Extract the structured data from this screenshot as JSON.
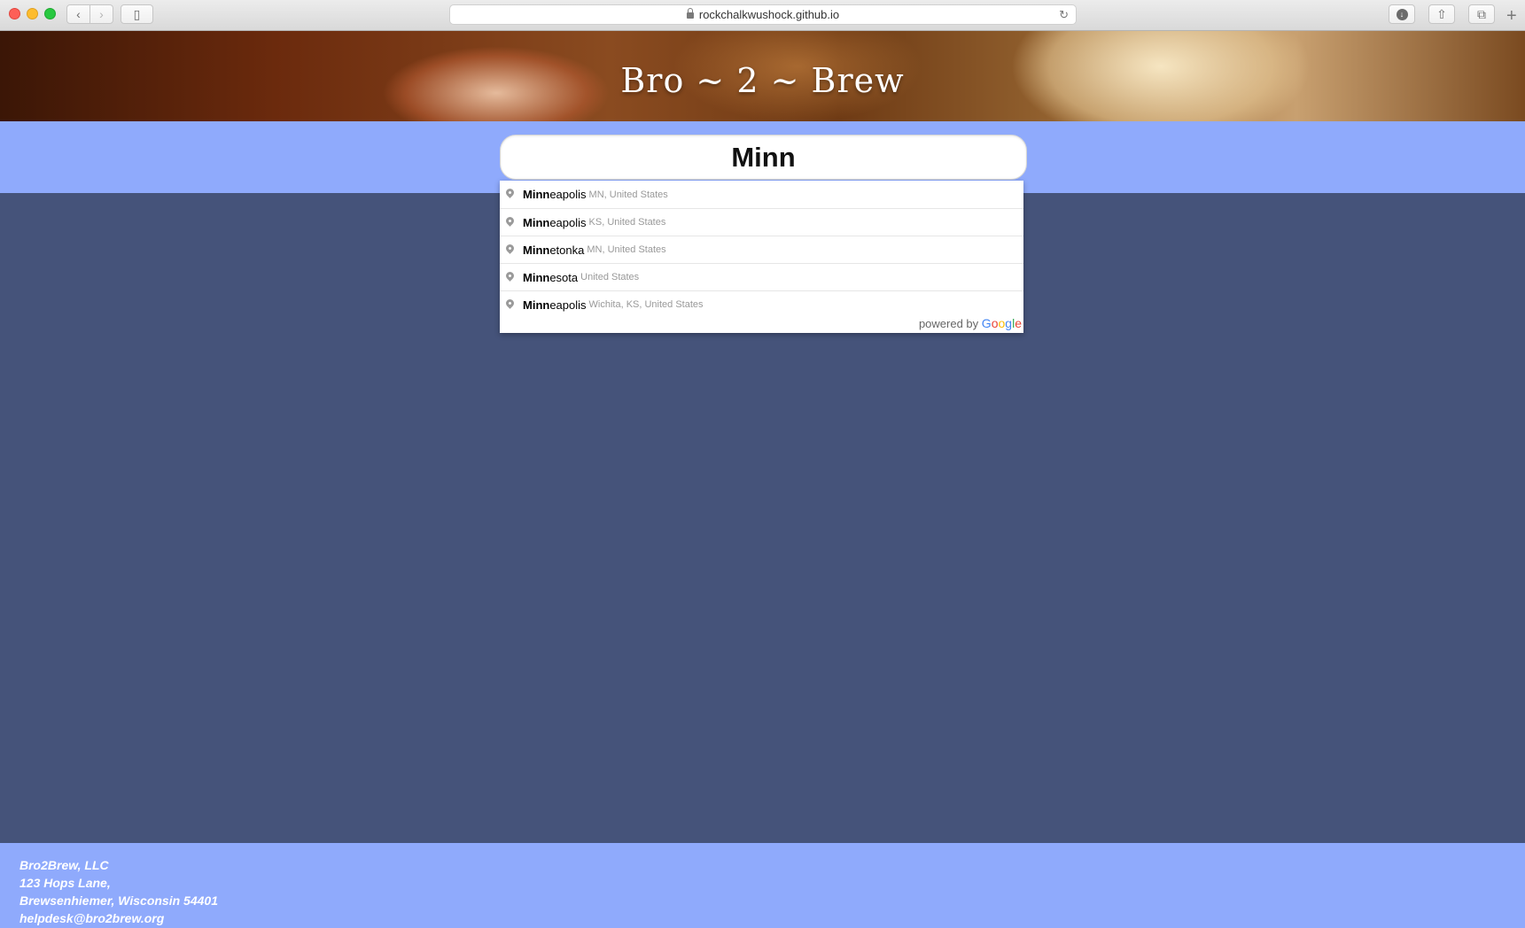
{
  "browser": {
    "url": "rockchalkwushock.github.io"
  },
  "site": {
    "title": "Bro ~ 2 ~ Brew"
  },
  "search": {
    "value": "Minn"
  },
  "autocomplete": {
    "items": [
      {
        "match": "Minn",
        "rest": "eapolis",
        "secondary": "MN, United States"
      },
      {
        "match": "Minn",
        "rest": "eapolis",
        "secondary": "KS, United States"
      },
      {
        "match": "Minn",
        "rest": "etonka",
        "secondary": "MN, United States"
      },
      {
        "match": "Minn",
        "rest": "esota",
        "secondary": "United States"
      },
      {
        "match": "Minn",
        "rest": "eapolis",
        "secondary": "Wichita, KS, United States"
      }
    ],
    "powered_by": "powered by",
    "logo_letters": [
      "G",
      "o",
      "o",
      "g",
      "l",
      "e"
    ]
  },
  "footer": {
    "company": "Bro2Brew, LLC",
    "street": "123 Hops Lane,",
    "city": "Brewsenhiemer, Wisconsin 54401",
    "email": "helpdesk@bro2brew.org"
  },
  "colors": {
    "band": "#8faafc",
    "body": "#45537a"
  }
}
